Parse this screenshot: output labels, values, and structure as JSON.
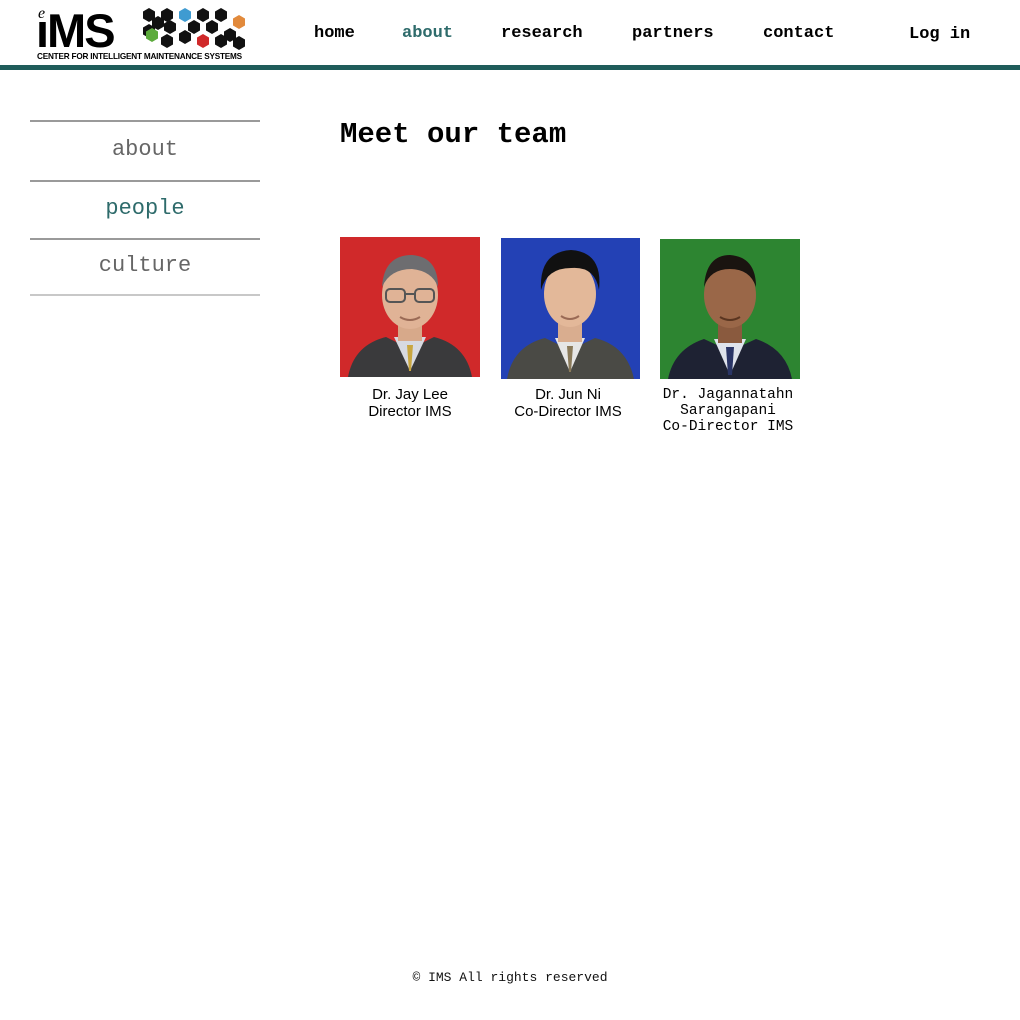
{
  "header": {
    "logo": {
      "prefix": "e",
      "name": "iMS",
      "tagline": "CENTER FOR INTELLIGENT MAINTENANCE SYSTEMS"
    },
    "nav": [
      {
        "label": "home",
        "active": false
      },
      {
        "label": "about",
        "active": true
      },
      {
        "label": "research",
        "active": false
      },
      {
        "label": "partners",
        "active": false
      },
      {
        "label": "contact",
        "active": false
      }
    ],
    "login_label": "Log in",
    "accent_color": "#1f5c5a",
    "active_color": "#2e6b6b"
  },
  "sidebar": {
    "items": [
      {
        "label": "about",
        "active": false
      },
      {
        "label": "people",
        "active": true
      },
      {
        "label": "culture",
        "active": false
      }
    ]
  },
  "main": {
    "title": "Meet our team",
    "team": [
      {
        "name": "Dr. Jay Lee",
        "role": "Director IMS",
        "photo_bg": "#d0292a"
      },
      {
        "name": "Dr. Jun Ni",
        "role": "Co-Director IMS",
        "photo_bg": "#2341b5"
      },
      {
        "name_line1": "Dr. Jagannatahn",
        "name_line2": "Sarangapani",
        "role": "Co-Director IMS",
        "photo_bg": "#2d8531"
      }
    ]
  },
  "footer": {
    "copyright": "© IMS All rights reserved"
  }
}
